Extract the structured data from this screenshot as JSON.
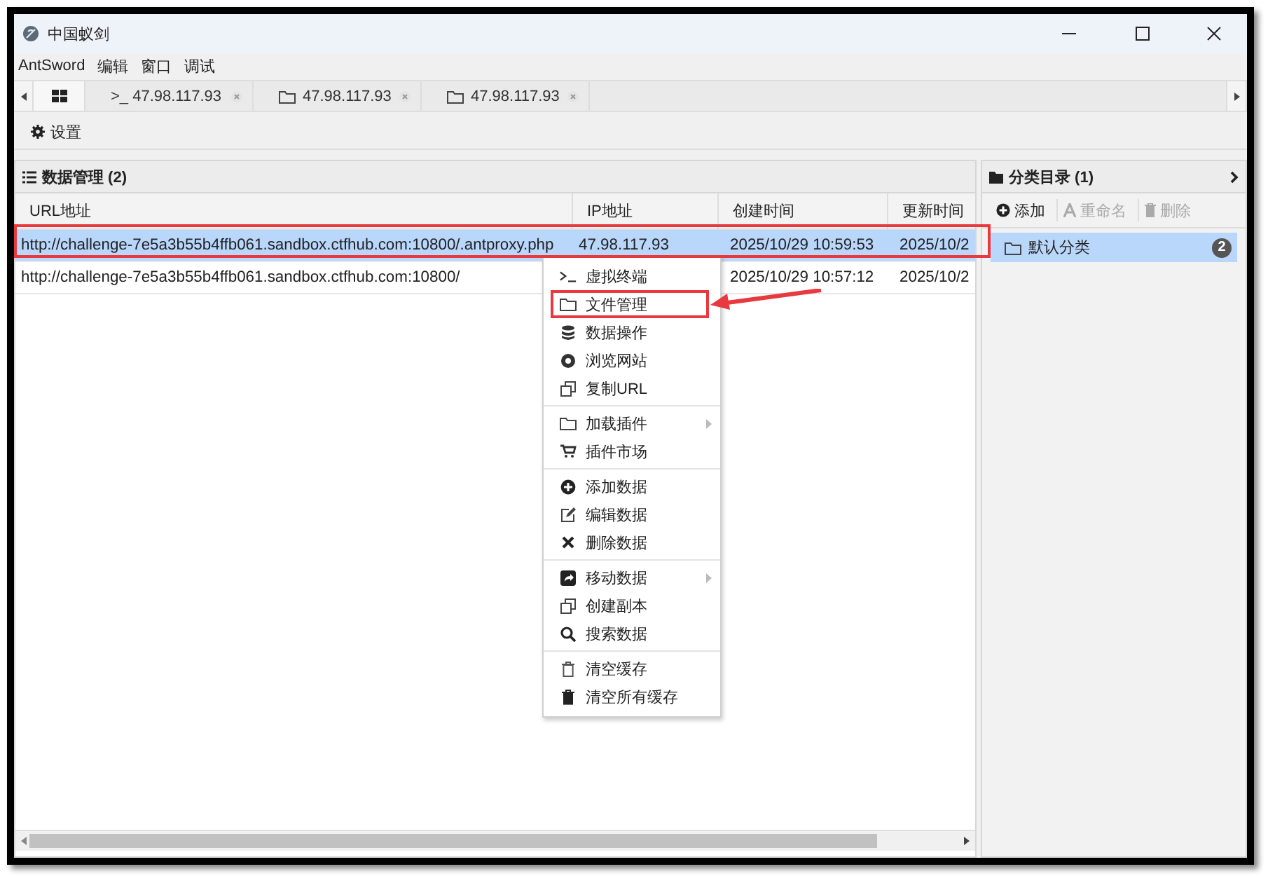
{
  "window": {
    "title": "中国蚁剑"
  },
  "menu_bar": [
    "AntSword",
    "编辑",
    "窗口",
    "调试"
  ],
  "tabs": [
    {
      "kind": "home",
      "selected": true
    },
    {
      "kind": "terminal",
      "label": ">_ 47.98.117.93",
      "selected": false
    },
    {
      "kind": "folder",
      "label": "47.98.117.93",
      "selected": false
    },
    {
      "kind": "folder",
      "label": "47.98.117.93",
      "selected": false
    }
  ],
  "toolbar": [
    "设置"
  ],
  "data_panel": {
    "title": "数据管理 (2)",
    "columns": [
      "URL地址",
      "IP地址",
      "创建时间",
      "更新时间"
    ],
    "rows": [
      {
        "url": "http://challenge-7e5a3b55b4ffb061.sandbox.ctfhub.com:10800/.antproxy.php",
        "ip": "47.98.117.93",
        "created": "2025/10/29 10:59:53",
        "updated": "2025/10/2",
        "selected": true
      },
      {
        "url": "http://challenge-7e5a3b55b4ffb061.sandbox.ctfhub.com:10800/",
        "created": "2025/10/29 10:57:12",
        "updated": "2025/10/2",
        "selected": false
      }
    ]
  },
  "context_menu": [
    [
      {
        "label": "虚拟终端",
        "submenu": false
      },
      {
        "label": "文件管理",
        "submenu": false
      },
      {
        "label": "数据操作",
        "submenu": false
      },
      {
        "label": "浏览网站",
        "submenu": false
      },
      {
        "label": "复制URL",
        "submenu": false
      }
    ],
    [
      {
        "label": "加载插件",
        "submenu": true
      },
      {
        "label": "插件市场",
        "submenu": false
      }
    ],
    [
      {
        "label": "添加数据",
        "submenu": false
      },
      {
        "label": "编辑数据",
        "submenu": false
      },
      {
        "label": "删除数据",
        "submenu": false
      }
    ],
    [
      {
        "label": "移动数据",
        "submenu": true
      },
      {
        "label": "创建副本",
        "submenu": false
      },
      {
        "label": "搜索数据",
        "submenu": false
      }
    ],
    [
      {
        "label": "清空缓存",
        "submenu": false
      },
      {
        "label": "清空所有缓存",
        "submenu": false
      }
    ]
  ],
  "category_panel": {
    "title": "分类目录 (1)",
    "buttons": [
      {
        "label": "添加",
        "disabled": false
      },
      {
        "label": "重命名",
        "disabled": true
      },
      {
        "label": "删除",
        "disabled": true
      }
    ],
    "items": [
      {
        "label": "默认分类",
        "count": "2",
        "selected": true
      }
    ]
  }
}
